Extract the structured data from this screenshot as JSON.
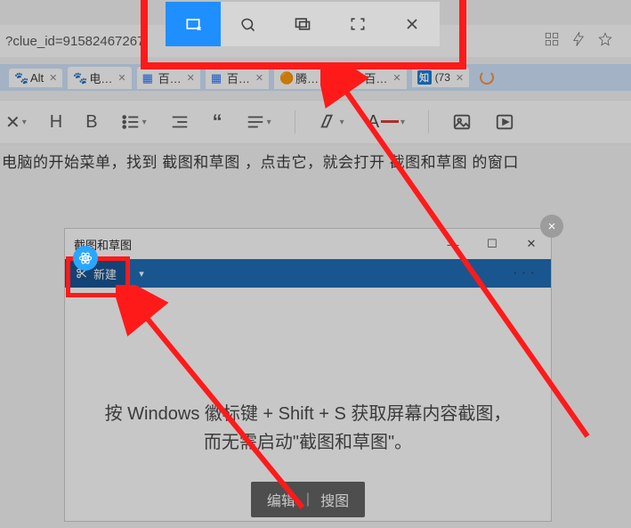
{
  "address_bar": {
    "url_fragment": "?clue_id=91582467267"
  },
  "tabs": [
    {
      "label": "Alt",
      "fav": "paw",
      "name": "tab-alt"
    },
    {
      "label": "电…",
      "fav": "paw",
      "name": "tab-dian"
    },
    {
      "label": "百…",
      "fav": "grid",
      "name": "tab-bai1"
    },
    {
      "label": "百…",
      "fav": "grid",
      "name": "tab-bai2"
    },
    {
      "label": "腾…",
      "fav": "orange",
      "name": "tab-teng"
    },
    {
      "label": "百…",
      "fav": "cyan",
      "name": "tab-bai3"
    },
    {
      "label": "(73",
      "fav": "zhi",
      "name": "tab-zhi"
    }
  ],
  "toolbar": {
    "heading_letter": "H",
    "bold_letter": "B",
    "color_letter": "A"
  },
  "body_text": "电脑的开始菜单，找到  截图和草图  ，点击它，就会打开  截图和草图  的窗口",
  "snip_window": {
    "title": "截图和草图",
    "new_label": "新建",
    "more_dots": "· · ·",
    "hint_line1": "按 Windows 徽标键 + Shift + S 获取屏幕内容截图，",
    "hint_line2": "而无需启动\"截图和草图\"。",
    "action_edit": "编辑",
    "action_search": "搜图"
  },
  "gray_close": "×",
  "snip_popup_icons": [
    "rect-snip",
    "freeform-snip",
    "window-snip",
    "fullscreen-snip",
    "close"
  ]
}
